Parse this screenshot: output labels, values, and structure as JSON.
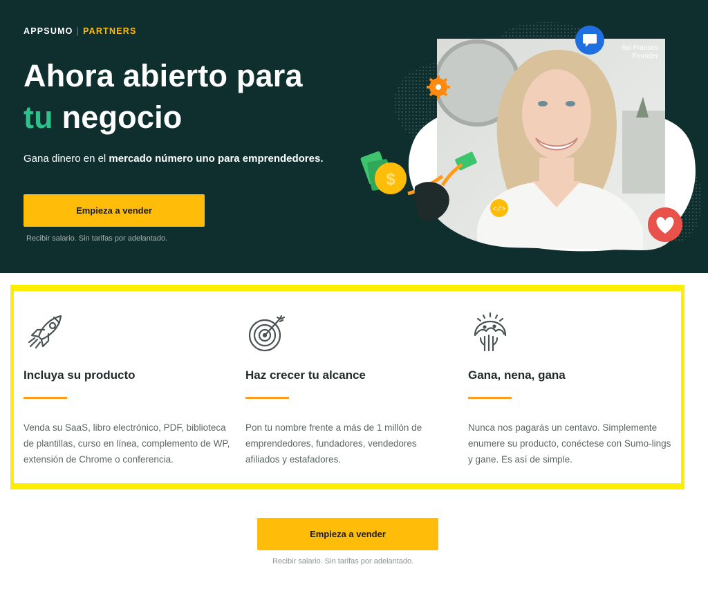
{
  "brand": {
    "name": "APPSUMO",
    "separator": "|",
    "product": "PARTNERS"
  },
  "hero": {
    "headline_line1": "Ahora abierto para",
    "headline_accent": "tu",
    "headline_rest": " negocio",
    "subtitle_prefix": "Gana dinero en el ",
    "subtitle_bold": "mercado número uno para emprendedores.",
    "cta_label": "Empieza a vender",
    "note": "Recibir salario. Sin tarifas por adelantado.",
    "person_name": "Sai Frances",
    "person_role": "Founder"
  },
  "features": [
    {
      "icon": "rocket-icon",
      "title": "Incluya su producto",
      "text": "Venda su SaaS, libro electrónico, PDF, biblioteca de plantillas, curso en línea, complemento de WP, extensión de Chrome o conferencia."
    },
    {
      "icon": "target-icon",
      "title": "Haz crecer tu alcance",
      "text": "Pon tu nombre frente a más de 1 millón de emprendedores, fundadores, vendedores afiliados y estafadores."
    },
    {
      "icon": "taco-hand-icon",
      "title": "Gana, nena, gana",
      "text": "Nunca nos pagarás un centavo. Simplemente enumere su producto, conéctese con Sumo-lings y gane. Es así de simple."
    }
  ],
  "bottom": {
    "cta_label": "Empieza a vender",
    "note": "Recibir salario. Sin tarifas por adelantado."
  },
  "colors": {
    "hero_bg": "#0f2f2e",
    "accent_green": "#2cc28a",
    "brand_yellow": "#ffbd0a",
    "highlight_border": "#fdee00",
    "rule_orange": "#ff9b1a"
  }
}
